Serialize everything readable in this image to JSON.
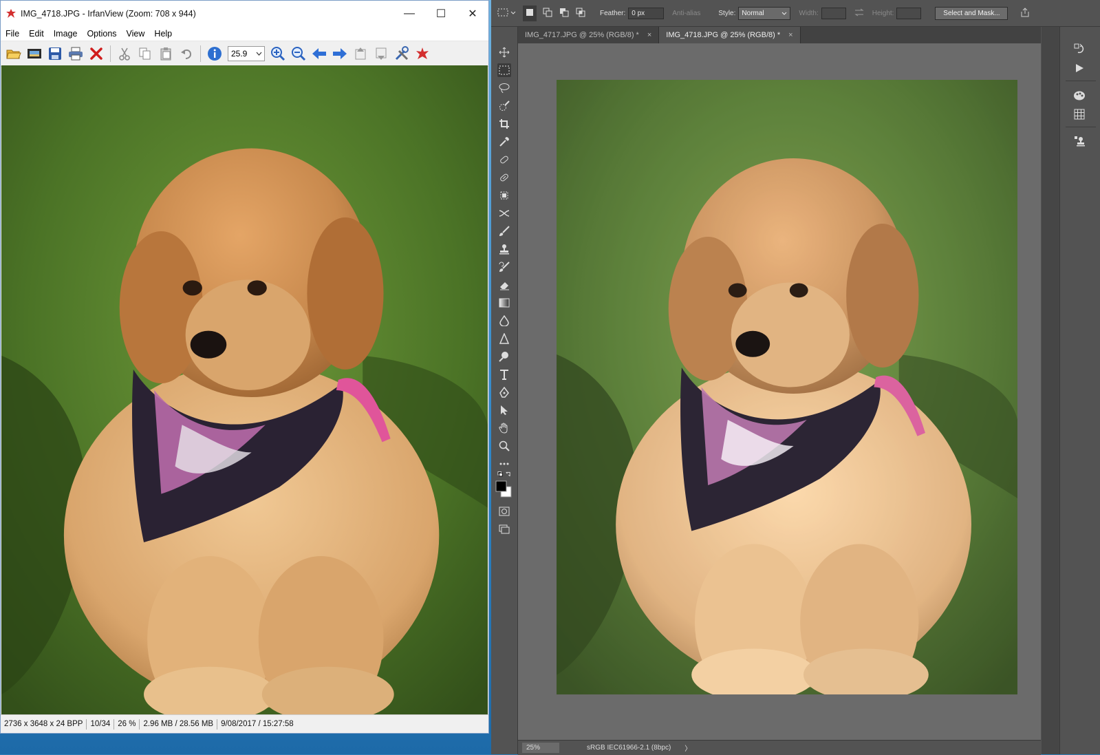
{
  "irfanview": {
    "title": "IMG_4718.JPG - IrfanView (Zoom: 708 x 944)",
    "window_buttons": {
      "minimize": "—",
      "maximize": "☐",
      "close": "✕"
    },
    "menu": [
      "File",
      "Edit",
      "Image",
      "Options",
      "View",
      "Help"
    ],
    "zoom_value": "25.9",
    "status": {
      "dimensions": "2736 x 3648 x 24 BPP",
      "index": "10/34",
      "zoom": "26 %",
      "size": "2.96 MB / 28.56 MB",
      "datetime": "9/08/2017 / 15:27:58"
    }
  },
  "photoshop": {
    "options": {
      "feather_label": "Feather:",
      "feather_value": "0 px",
      "antialias_label": "Anti-alias",
      "style_label": "Style:",
      "style_value": "Normal",
      "width_label": "Width:",
      "height_label": "Height:",
      "select_mask_label": "Select and Mask..."
    },
    "tabs": [
      {
        "label": "IMG_4717.JPG @ 25% (RGB/8) *",
        "close": "×"
      },
      {
        "label": "IMG_4718.JPG @ 25% (RGB/8) *",
        "close": "×"
      }
    ],
    "status": {
      "zoom": "25%",
      "profile": "sRGB IEC61966-2.1 (8bpc)",
      "arrow": "〉"
    }
  },
  "colors": {
    "ps_background": "#535353",
    "ps_canvas": "#6b6b6b",
    "grass": "#4f7a2a",
    "dog_fur": "#c98a4e",
    "bandana_pink": "#e0559a"
  }
}
